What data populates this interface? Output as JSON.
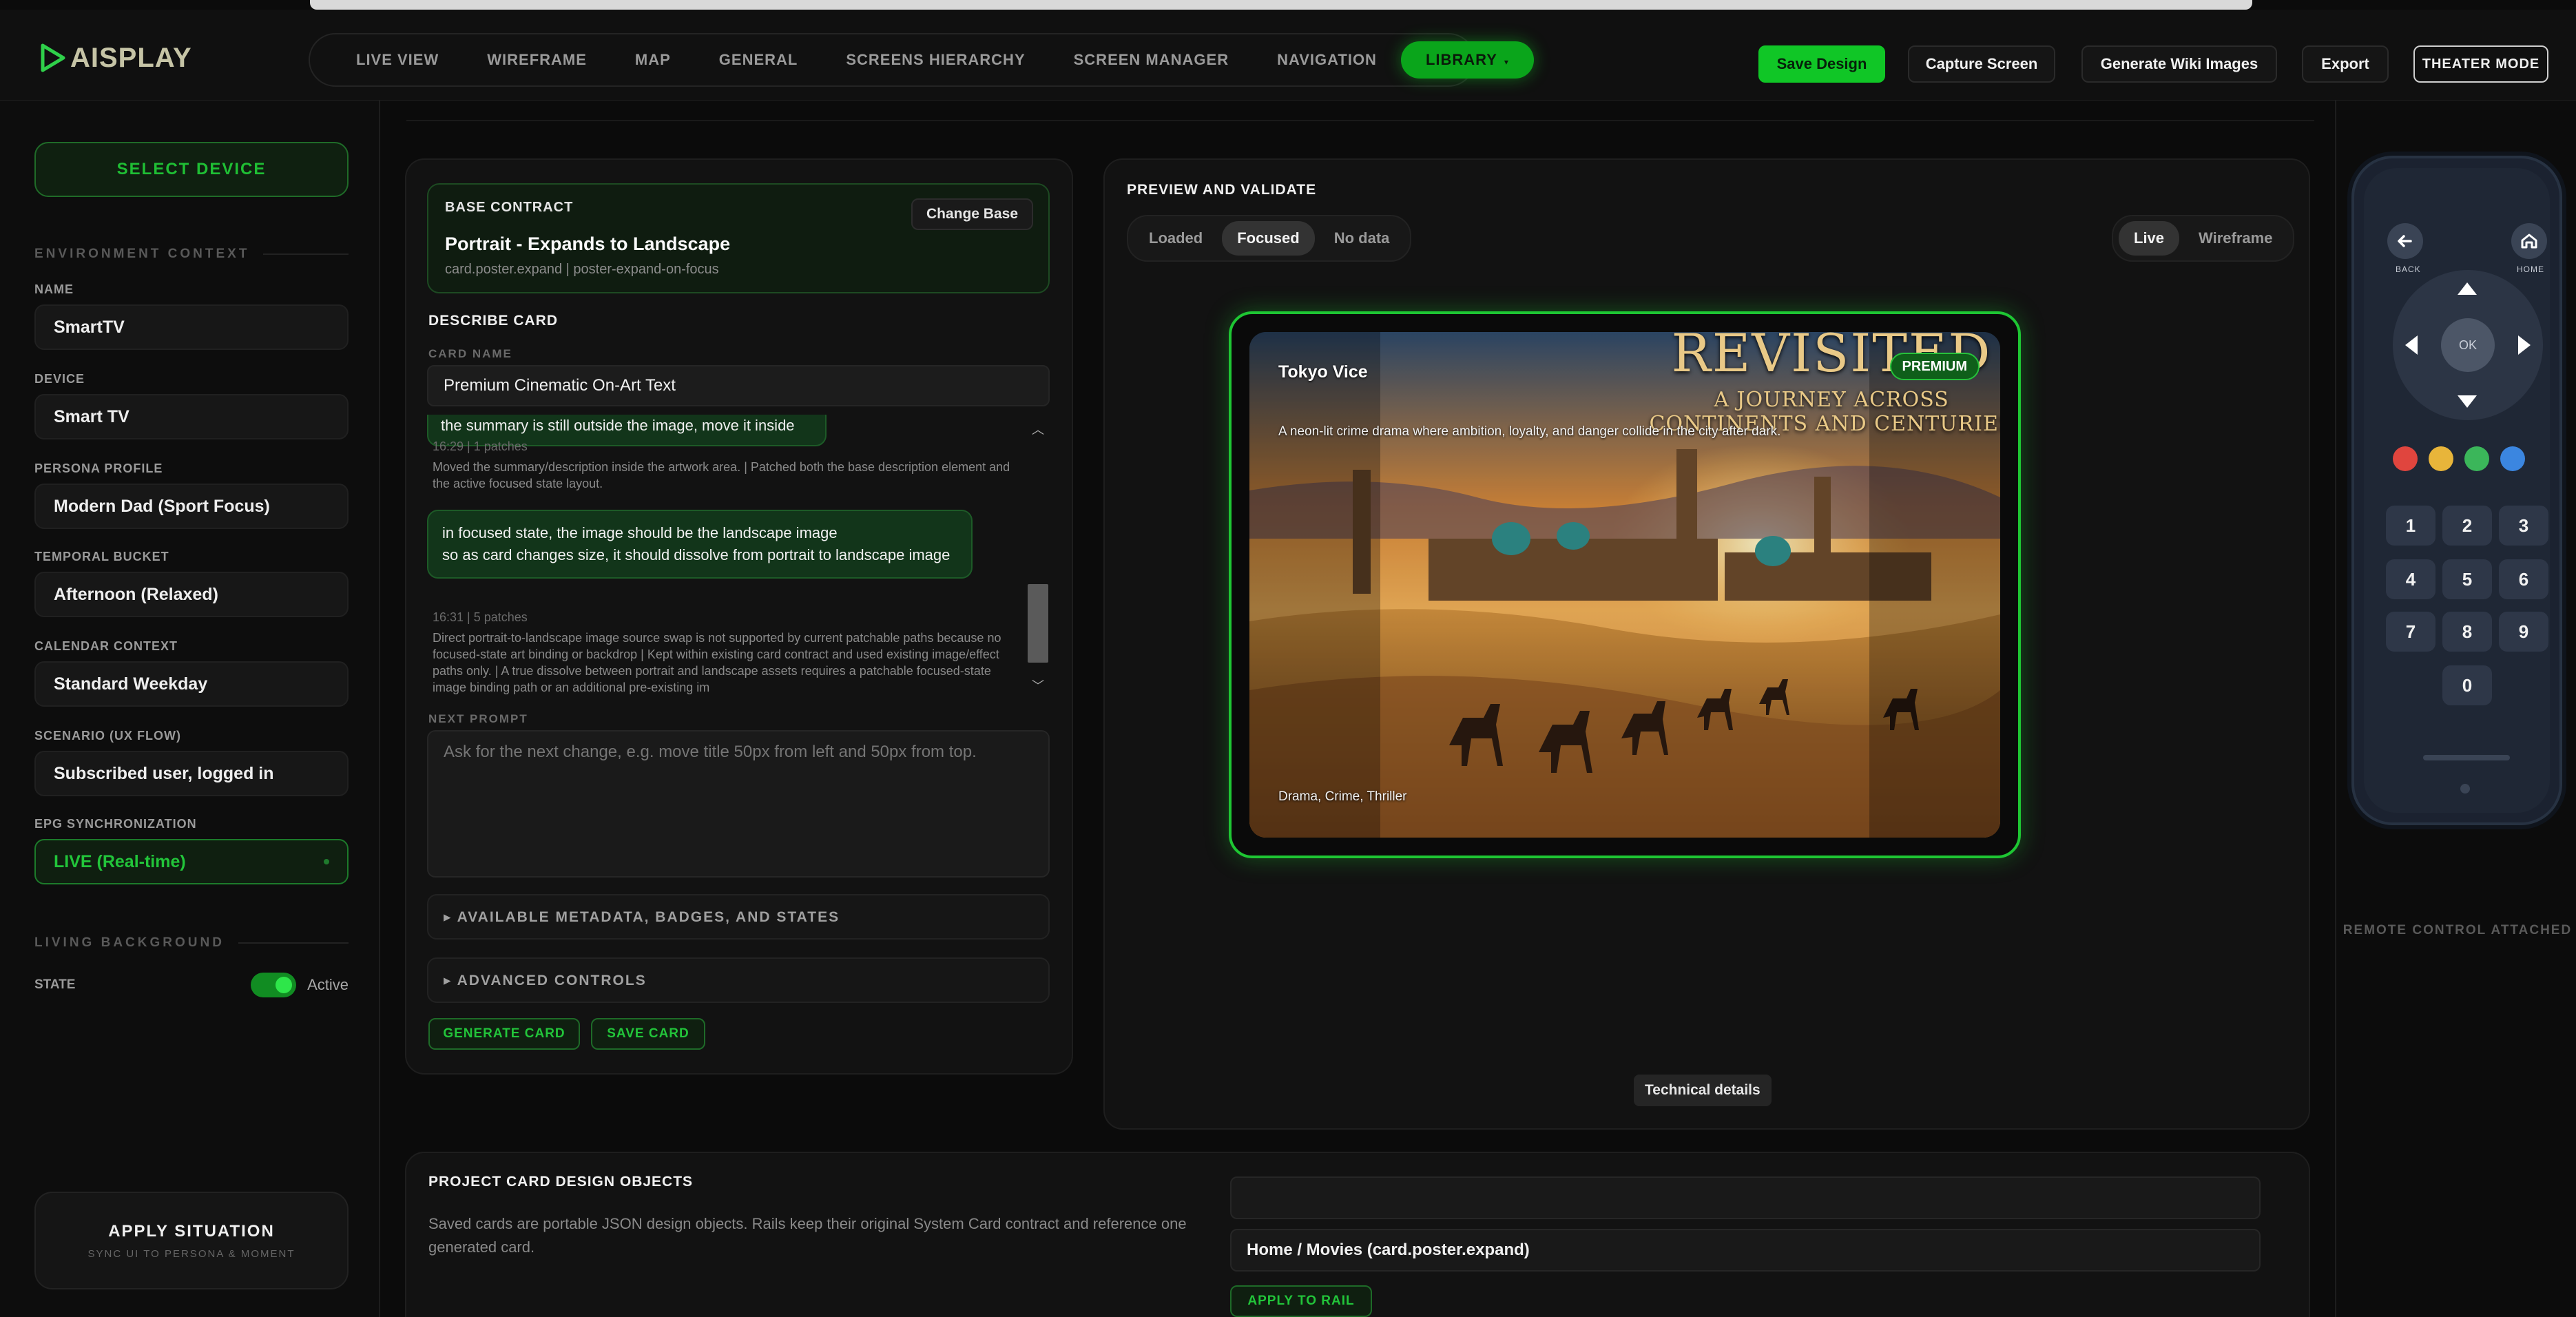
{
  "app": {
    "logo_text": "AISPLAY"
  },
  "nav": {
    "items": [
      "LIVE VIEW",
      "WIREFRAME",
      "MAP",
      "GENERAL",
      "SCREENS HIERARCHY",
      "SCREEN MANAGER",
      "NAVIGATION"
    ],
    "active": "LIBRARY",
    "active_caret": "▾"
  },
  "toolbar": {
    "save_design": "Save Design",
    "capture_screen": "Capture Screen",
    "generate_wiki": "Generate Wiki Images",
    "export": "Export",
    "theater_mode": "THEATER MODE"
  },
  "sidebar": {
    "select_device": "SELECT DEVICE",
    "environment_context": "ENVIRONMENT CONTEXT",
    "fields": [
      {
        "label": "NAME",
        "value": "SmartTV"
      },
      {
        "label": "DEVICE",
        "value": "Smart TV"
      },
      {
        "label": "PERSONA PROFILE",
        "value": "Modern Dad (Sport Focus)"
      },
      {
        "label": "TEMPORAL BUCKET",
        "value": "Afternoon (Relaxed)"
      },
      {
        "label": "CALENDAR CONTEXT",
        "value": "Standard Weekday"
      },
      {
        "label": "SCENARIO (UX FLOW)",
        "value": "Subscribed user, logged in"
      },
      {
        "label": "EPG SYNCHRONIZATION",
        "value": "LIVE (Real-time)"
      }
    ],
    "living_background": "LIVING BACKGROUND",
    "state_label": "STATE",
    "state_value": "Active",
    "state_on": true,
    "apply_title": "APPLY SITUATION",
    "apply_sub": "SYNC UI TO PERSONA & MOMENT"
  },
  "editor": {
    "base_contract_label": "BASE CONTRACT",
    "change_base": "Change Base",
    "base_title": "Portrait - Expands to Landscape",
    "base_sub": "card.poster.expand | poster-expand-on-focus",
    "describe_card": "DESCRIBE CARD",
    "card_name_label": "CARD NAME",
    "card_name": "Premium Cinematic On-Art Text",
    "chat": [
      {
        "kind": "bubble",
        "text": "the summary is still outside the image, move it inside"
      },
      {
        "kind": "meta",
        "text": "16:29 | 1 patches"
      },
      {
        "kind": "note",
        "text": "Moved the summary/description inside the artwork area. | Patched both the base description element and the active focused state layout."
      },
      {
        "kind": "bubble",
        "text": "in focused state, the image should be the landscape image\nso as card changes size, it should dissolve from portrait to landscape image"
      },
      {
        "kind": "meta",
        "text": "16:31 | 5 patches"
      },
      {
        "kind": "note",
        "text": "Direct portrait-to-landscape image source swap is not supported by current patchable paths because no focused-state art binding or backdrop | Kept within existing card contract and used existing image/effect paths only. | A true dissolve between portrait and landscape assets requires a patchable focused-state image binding path or an additional pre-existing im"
      }
    ],
    "next_prompt_label": "NEXT PROMPT",
    "next_prompt_placeholder": "Ask for the next change, e.g. move title 50px from left and 50px from top.",
    "metadata_section": "▸ AVAILABLE METADATA, BADGES, AND STATES",
    "advanced_section": "▸ ADVANCED CONTROLS",
    "generate_card": "GENERATE CARD",
    "save_card": "SAVE CARD"
  },
  "preview": {
    "title": "PREVIEW AND VALIDATE",
    "states": [
      "Loaded",
      "Focused",
      "No data"
    ],
    "active_state": "Focused",
    "modes": [
      "Live",
      "Wireframe"
    ],
    "active_mode": "Live",
    "card": {
      "title": "Tokyo Vice",
      "description": "A neon-lit crime drama where ambition, loyalty, and danger collide in the city after dark.",
      "genres": "Drama, Crime, Thriller",
      "badge": "PREMIUM",
      "art_title": "REVISITED",
      "art_subtitle_1": "A JOURNEY ACROSS",
      "art_subtitle_2": "CONTINENTS AND CENTURIES"
    },
    "technical_details": "Technical details"
  },
  "remote": {
    "back": "BACK",
    "home": "HOME",
    "ok": "OK",
    "keys": [
      "1",
      "2",
      "3",
      "4",
      "5",
      "6",
      "7",
      "8",
      "9",
      "0"
    ],
    "colors": [
      "#e0453e",
      "#e8b53a",
      "#3bb65a",
      "#3b86e0"
    ],
    "attached": "REMOTE CONTROL ATTACHED"
  },
  "project": {
    "title": "PROJECT CARD DESIGN OBJECTS",
    "description": "Saved cards are portable JSON design objects. Rails keep their original System Card contract and reference one generated card.",
    "search_value": "",
    "rail": "Home / Movies (card.poster.expand)",
    "apply_to_rail": "APPLY TO RAIL"
  }
}
